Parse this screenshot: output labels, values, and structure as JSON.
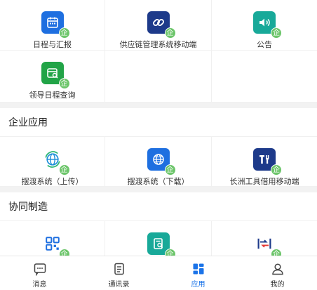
{
  "badge_text": "企",
  "section_top": {
    "apps": [
      {
        "label": "日程与汇报",
        "icon": "calendar-icon",
        "color": "#1e6fe0"
      },
      {
        "label": "供应链管理系统移动端",
        "icon": "link-icon",
        "color": "#1d3a8a"
      },
      {
        "label": "公告",
        "icon": "speaker-icon",
        "color": "#18a999"
      },
      {
        "label": "领导日程查询",
        "icon": "calendar-search-icon",
        "color": "#22a447"
      }
    ]
  },
  "section_enterprise": {
    "title": "企业应用",
    "apps": [
      {
        "label": "摆渡系统（上传）",
        "icon": "globe-refresh-icon",
        "color": "#1f8fd8"
      },
      {
        "label": "摆渡系统（下载）",
        "icon": "globe-icon",
        "color": "#1e6fe0"
      },
      {
        "label": "长洲工具借用移动端",
        "icon": "tools-icon",
        "color": "#1d3a8a"
      }
    ]
  },
  "section_collab": {
    "title": "协同制造",
    "apps": [
      {
        "label": "",
        "icon": "qr-scan-icon",
        "color": "#1e6fe0"
      },
      {
        "label": "",
        "icon": "document-search-icon",
        "color": "#18a999"
      },
      {
        "label": "",
        "icon": "transfer-arrows-icon",
        "color": "#1d3a8a"
      }
    ]
  },
  "tabbar": {
    "tabs": [
      {
        "label": "消息",
        "icon": "message-icon",
        "active": false
      },
      {
        "label": "通讯录",
        "icon": "contacts-icon",
        "active": false
      },
      {
        "label": "应用",
        "icon": "apps-icon",
        "active": true
      },
      {
        "label": "我的",
        "icon": "profile-icon",
        "active": false
      }
    ],
    "active_color": "#1a73e8"
  }
}
